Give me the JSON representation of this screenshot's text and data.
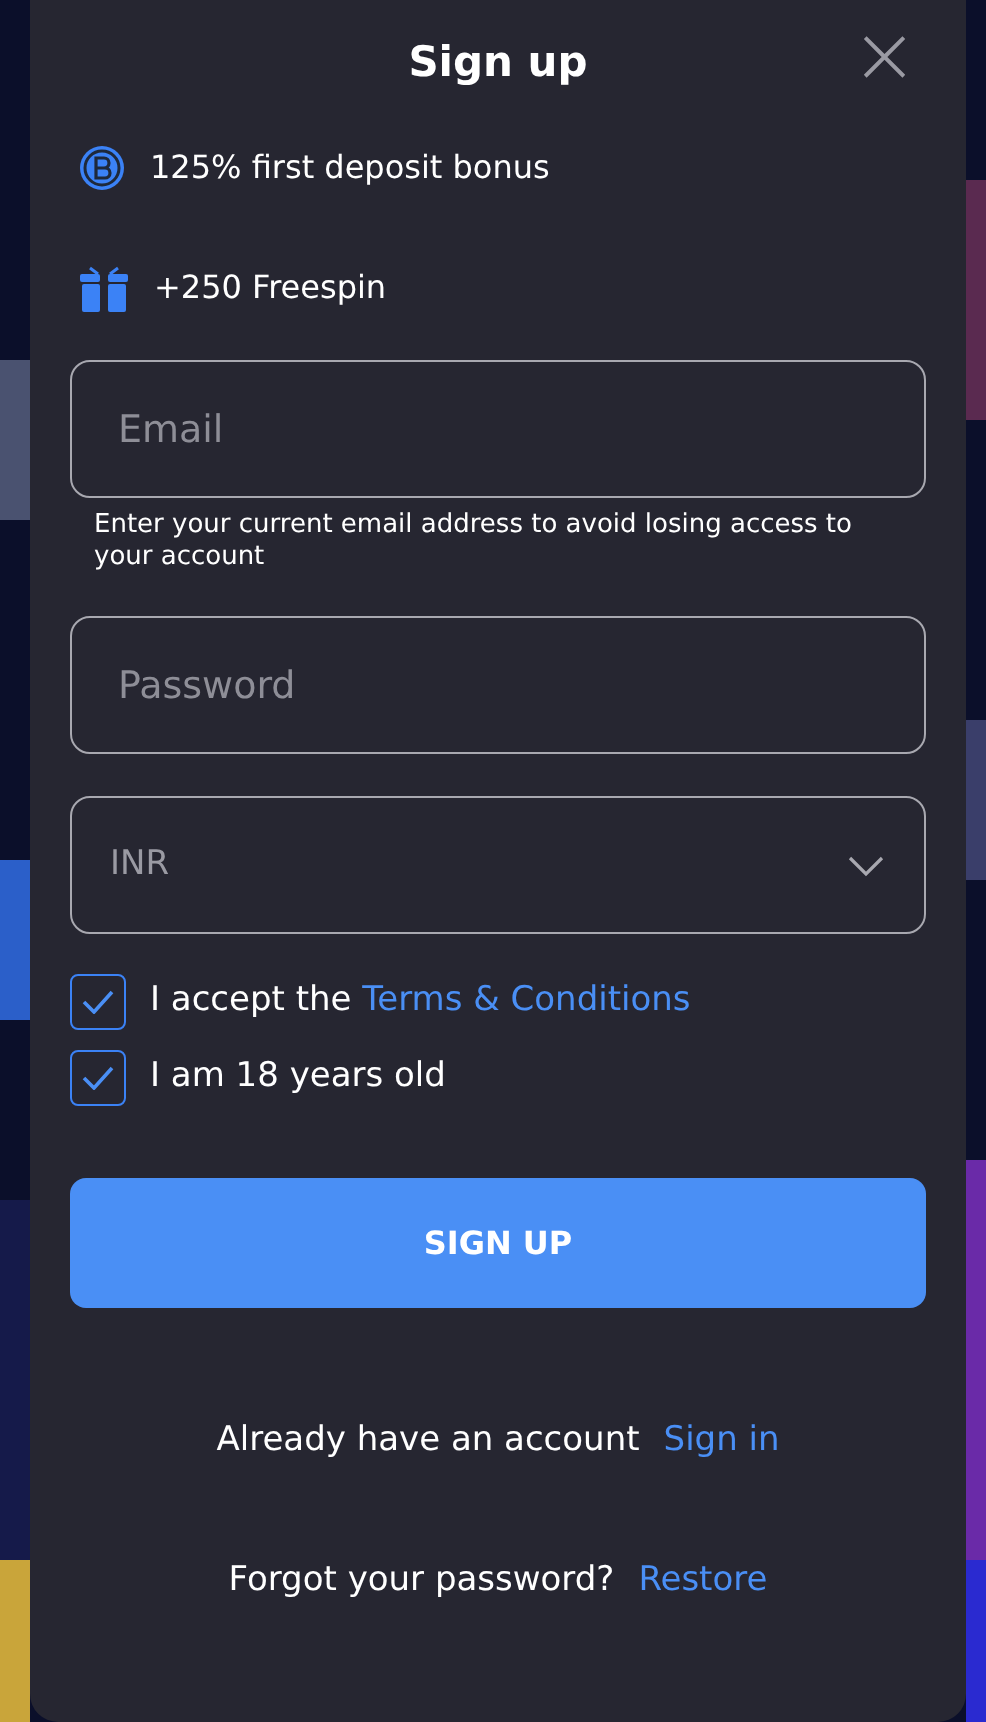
{
  "dialog": {
    "title": "Sign up",
    "close": "×"
  },
  "bonuses": [
    {
      "kind": "coin",
      "text": "125% first deposit bonus"
    },
    {
      "kind": "gift",
      "text": "+250 Freespin"
    }
  ],
  "fields": [
    {
      "kind": "text",
      "placeholder": "Email",
      "hint": "Enter your current email address to avoid losing access to your account"
    },
    {
      "kind": "password",
      "placeholder": "Password"
    },
    {
      "kind": "select",
      "value": "INR"
    }
  ],
  "checkboxes": [
    {
      "text": "I accept the ",
      "link": "Terms & Conditions",
      "checked": true
    },
    {
      "text": "I am 18 years old",
      "checked": true
    }
  ],
  "submit": "SIGN UP",
  "footer_links": [
    {
      "text": "Already have an account",
      "link": "Sign in"
    },
    {
      "text": "Forgot your password?",
      "link": "Restore"
    }
  ]
}
